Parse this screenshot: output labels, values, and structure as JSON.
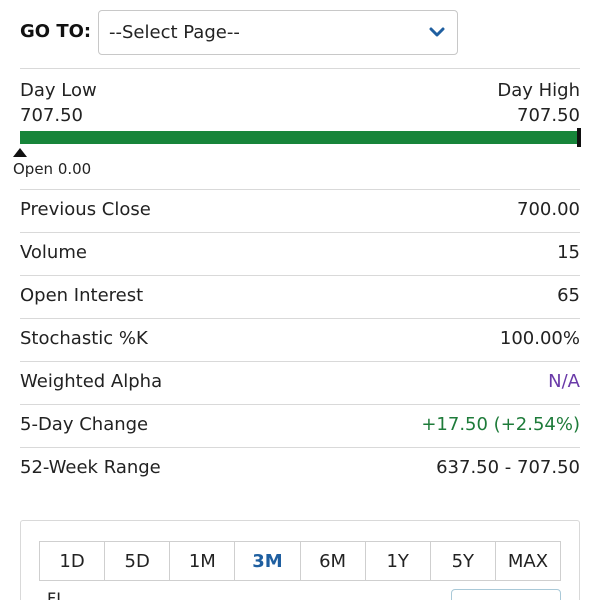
{
  "goto": {
    "label": "GO TO:",
    "select_value": "--Select Page--"
  },
  "day_range": {
    "low_label": "Day Low",
    "low_value": "707.50",
    "high_label": "Day High",
    "high_value": "707.50",
    "open_label": "Open 0.00",
    "bar_color": "#17853a"
  },
  "stats": [
    {
      "label": "Previous Close",
      "value": "700.00"
    },
    {
      "label": "Volume",
      "value": "15"
    },
    {
      "label": "Open Interest",
      "value": "65"
    },
    {
      "label": "Stochastic %K",
      "value": "100.00%"
    },
    {
      "label": "Weighted Alpha",
      "value": "N/A",
      "value_color": "#6a3aa8"
    },
    {
      "label": "5-Day Change",
      "value": "+17.50 (+2.54%)",
      "value_color": "#1e7b3a"
    },
    {
      "label": "52-Week Range",
      "value": "637.50 - 707.50"
    }
  ],
  "periods": {
    "tabs": [
      "1D",
      "5D",
      "1M",
      "3M",
      "6M",
      "1Y",
      "5Y",
      "MAX"
    ],
    "active": "3M",
    "active_color": "#1f5fa0"
  },
  "card_partial_text": "FL"
}
